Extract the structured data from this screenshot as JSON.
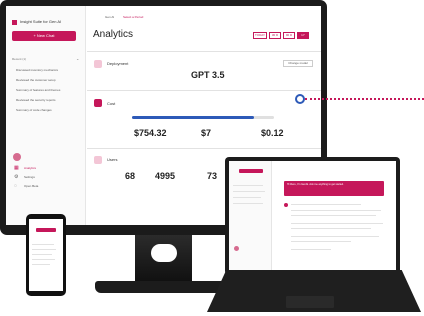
{
  "app": {
    "title": "Insight Suite for Gen AI",
    "new_chat_label": "+ New Chat",
    "recent_label": "Recent (1)",
    "history": [
      "Discussed inventory mechanics",
      "Reviewed the customer setup",
      "Summary of features and themes",
      "Reviewed the security reports",
      "Summary of code changes"
    ],
    "nav": [
      "Analytics",
      "Settings",
      "Open Beta"
    ],
    "accent": "#c5175a"
  },
  "main": {
    "breadcrumb_home": "Gen AI",
    "breadcrumb_current": "Select a Period",
    "title": "Analytics",
    "range_buttons": [
      "TODAY",
      "30 D",
      "90 D",
      "1Y"
    ],
    "deployment": {
      "label": "Deployment",
      "value": "GPT 3.5",
      "button": "Change model"
    },
    "cost": {
      "label": "Cost",
      "value1": "$754.32",
      "value2": "$7",
      "value3": "$0.12",
      "progress": 0.86
    },
    "users": {
      "label": "Users",
      "value1": "68",
      "value2": "4995",
      "value3": "73"
    }
  },
  "tablet": {
    "banner_text": "Hi there, I'm GenAI. Ask me anything to get started."
  }
}
